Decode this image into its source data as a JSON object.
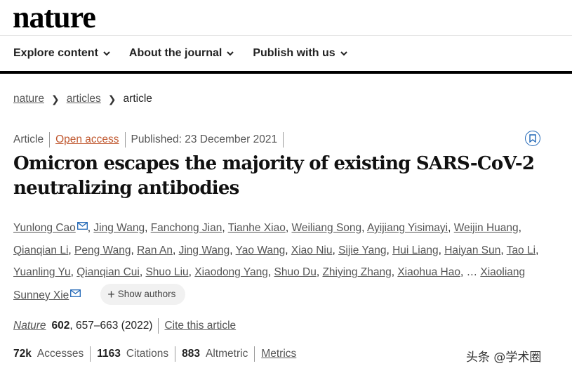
{
  "logo": "nature",
  "nav": {
    "items": [
      {
        "label": "Explore content"
      },
      {
        "label": "About the journal"
      },
      {
        "label": "Publish with us"
      }
    ]
  },
  "breadcrumb": {
    "items": [
      "nature",
      "articles",
      "article"
    ]
  },
  "meta": {
    "type": "Article",
    "access": "Open access",
    "published": "Published: 23 December 2021"
  },
  "title": "Omicron escapes the majority of existing SARS-CoV-2 neutralizing antibodies",
  "authors": {
    "list": [
      "Yunlong Cao",
      "Jing Wang",
      "Fanchong Jian",
      "Tianhe Xiao",
      "Weiliang Song",
      "Ayijiang Yisimayi",
      "Weijin Huang",
      "Qianqian Li",
      "Peng Wang",
      "Ran An",
      "Jing Wang",
      "Yao Wang",
      "Xiao Niu",
      "Sijie Yang",
      "Hui Liang",
      "Haiyan Sun",
      "Tao Li",
      "Yuanling Yu",
      "Qianqian Cui",
      "Shuo Liu",
      "Xiaodong Yang",
      "Shuo Du",
      "Zhiying Zhang",
      "Xiaohua Hao"
    ],
    "ellipsis": "…",
    "last": "Xiaoliang Sunney Xie",
    "show_label": "Show authors"
  },
  "citation": {
    "journal": "Nature",
    "volume": "602",
    "pages": ", 657–663 (2022)",
    "cite_label": "Cite this article"
  },
  "metrics": {
    "accesses_value": "72k",
    "accesses_label": "Accesses",
    "citations_value": "1163",
    "citations_label": "Citations",
    "altmetric_value": "883",
    "altmetric_label": "Altmetric",
    "metrics_label": "Metrics"
  },
  "watermark": "头条 @学术圈"
}
